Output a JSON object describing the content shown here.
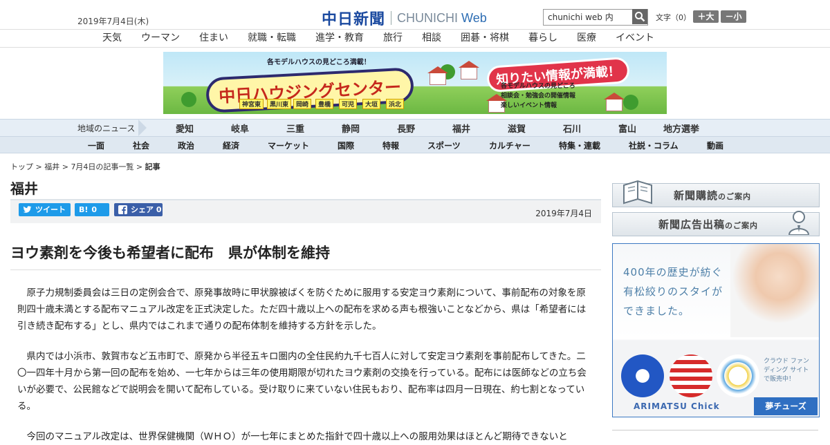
{
  "header": {
    "date": "2019年7月4日(木)",
    "logo_jp": "中日新聞",
    "logo_en": "CHUNICHI",
    "logo_web": "Web",
    "search_placeholder": "chunichi web 内",
    "text_size_label": "文字（0）",
    "size_up": "＋大",
    "size_down": "－小"
  },
  "category_nav": [
    "天気",
    "ウーマン",
    "住まい",
    "就職・転職",
    "進学・教育",
    "旅行",
    "相談",
    "囲碁・将棋",
    "暮らし",
    "医療",
    "イベント"
  ],
  "banner": {
    "top_text": "各モデルハウスの見どころ満載！",
    "title": "中日ハウジングセンター",
    "slogan": "知りたい情報が満載！",
    "locations": [
      "神宮東",
      "黒川東",
      "岡崎",
      "豊橋",
      "可児",
      "大垣",
      "浜北"
    ],
    "bullets": [
      "各モデルハウスの見どころ",
      "相談会・勉強会の開催情報",
      "楽しいイベント情報"
    ]
  },
  "region_nav": {
    "label": "地域のニュース",
    "items": [
      "愛知",
      "岐阜",
      "三重",
      "静岡",
      "長野",
      "福井",
      "滋賀",
      "石川",
      "富山",
      "地方選挙"
    ]
  },
  "section_nav": [
    "一面",
    "社会",
    "政治",
    "経済",
    "マーケット",
    "国際",
    "特報",
    "スポーツ",
    "カルチャー",
    "特集・連載",
    "社説・コラム",
    "動画"
  ],
  "breadcrumb": {
    "top": "トップ",
    "region": "福井",
    "list": "7月4日の記事一覧",
    "current": "記事",
    "sep": " > "
  },
  "page_title": "福井",
  "share": {
    "tweet": "ツイート",
    "hatena_icon": "B!",
    "hatena_count": "0",
    "facebook": "シェア",
    "facebook_count": "0"
  },
  "article": {
    "date": "2019年7月4日",
    "headline": "ヨウ素剤を今後も希望者に配布　県が体制を維持",
    "paragraphs": [
      "原子力規制委員会は三日の定例会合で、原発事故時に甲状腺被ばくを防ぐために服用する安定ヨウ素剤について、事前配布の対象を原則四十歳未満とする配布マニュアル改定を正式決定した。ただ四十歳以上への配布を求める声も根強いことなどから、県は「希望者には引き続き配布する」とし、県内ではこれまで通りの配布体制を維持する方針を示した。",
      "県内では小浜市、敦賀市など五市町で、原発から半径五キロ圏内の全住民約九千七百人に対して安定ヨウ素剤を事前配布してきた。二〇一四年十月から第一回の配布を始め、一七年からは三年の使用期限が切れたヨウ素剤の交換を行っている。配布には医師などの立ち会いが必要で、公民館などで説明会を開いて配布している。受け取りに来ていない住民もおり、配布率は四月一日現在、約七割となっている。",
      "今回のマニュアル改定は、世界保健機関（ＷＨＯ）が一七年にまとめた指針で四十歳以上への服用効果はほとんど期待できないと"
    ]
  },
  "sidebar": {
    "subscribe": "新聞購読",
    "subscribe_suffix": "のご案内",
    "advertise": "新聞広告出稿",
    "advertise_suffix": "のご案内",
    "ad": {
      "line1": "400年の歴史が紡ぐ",
      "line2": "有松絞りのスタイが",
      "line3": "できました。",
      "right_text": "クラウド ファンディング サイトで販売中！",
      "brand": "ARIMATSU Chick",
      "tag": "夢チューズ"
    }
  },
  "colors": {
    "brand_blue": "#1b4aa0",
    "nav_bg": "#e6eef6",
    "twitter": "#1e9be9",
    "facebook": "#3b5fa8",
    "ad_border": "#3b78c2"
  }
}
